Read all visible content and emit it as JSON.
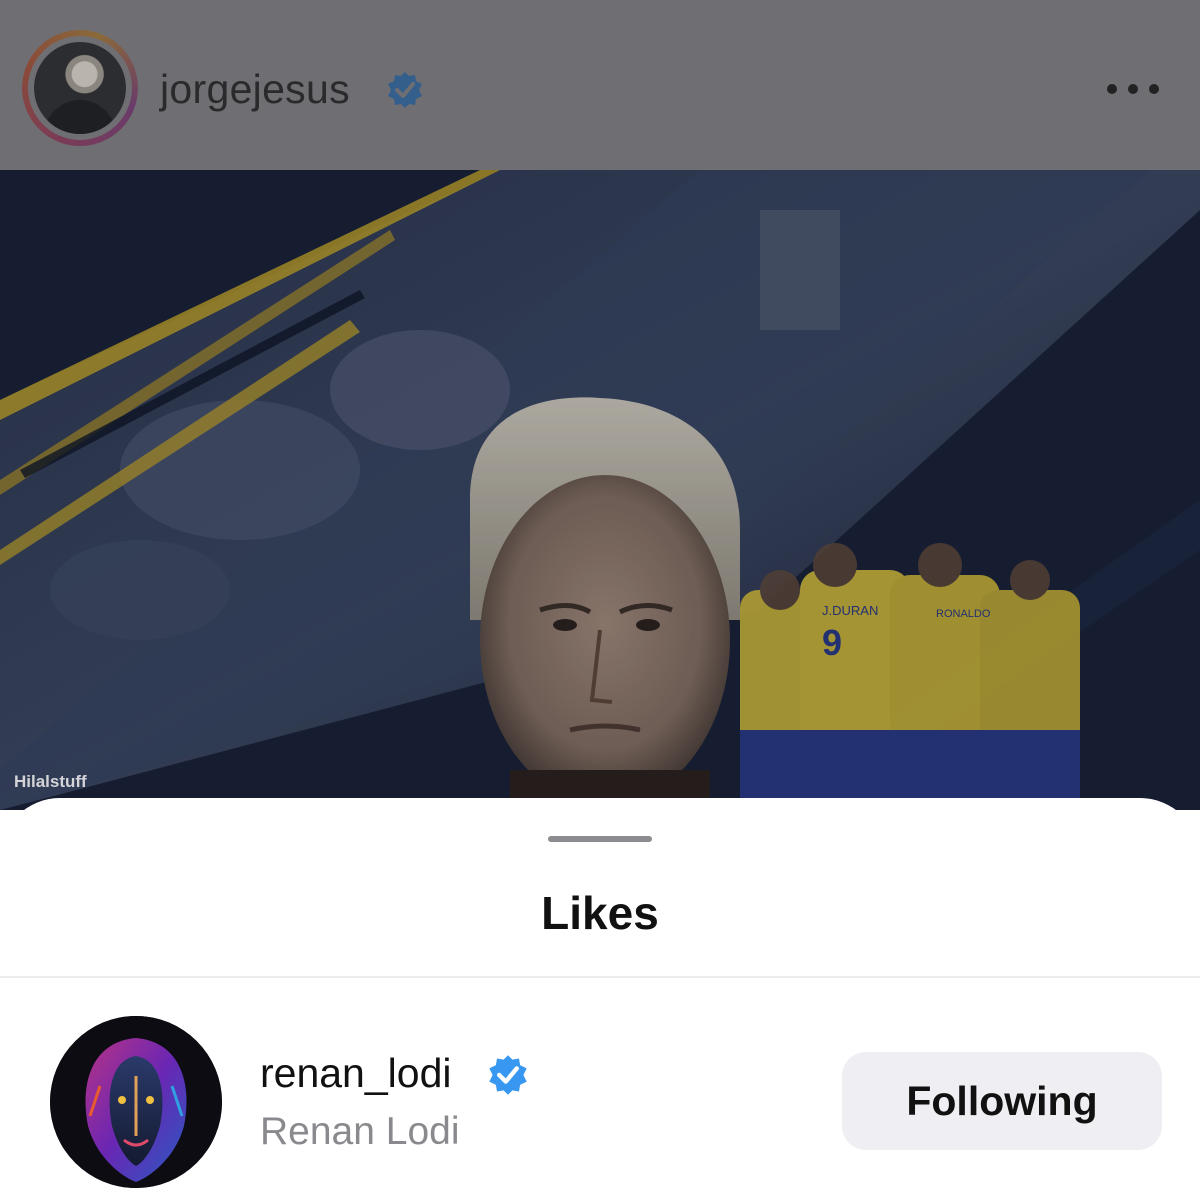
{
  "post": {
    "owner_username": "jorgejesus",
    "owner_verified": true,
    "more_icon": "more-horizontal-icon",
    "image_watermark": "Hilalstuff",
    "jersey_names": [
      "J.DURAN",
      "RONALDO"
    ],
    "jersey_number": "9"
  },
  "likes_sheet": {
    "title": "Likes",
    "users": [
      {
        "username": "renan_lodi",
        "full_name": "Renan Lodi",
        "verified": true,
        "button_label": "Following"
      }
    ]
  },
  "colors": {
    "verified_badge": "#3897f0",
    "header_dim": "#6f6f73",
    "sheet_background": "#ffffff",
    "following_button_bg": "#efeff3",
    "post_navy": "#1a2238",
    "kit_yellow": "#c9b43a"
  }
}
